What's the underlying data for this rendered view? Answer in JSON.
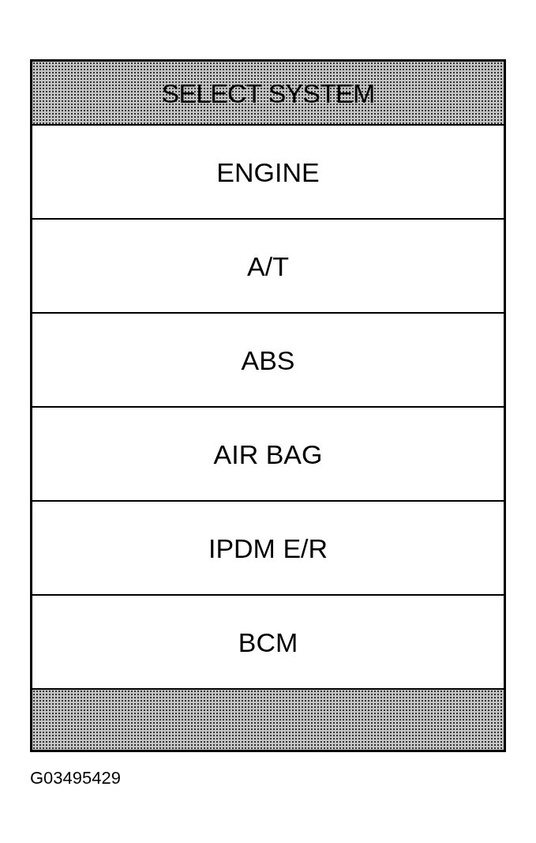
{
  "header": {
    "title": "SELECT SYSTEM"
  },
  "systems": [
    {
      "label": "ENGINE"
    },
    {
      "label": "A/T"
    },
    {
      "label": "ABS"
    },
    {
      "label": "AIR BAG"
    },
    {
      "label": "IPDM E/R"
    },
    {
      "label": "BCM"
    }
  ],
  "figure_id": "G03495429"
}
